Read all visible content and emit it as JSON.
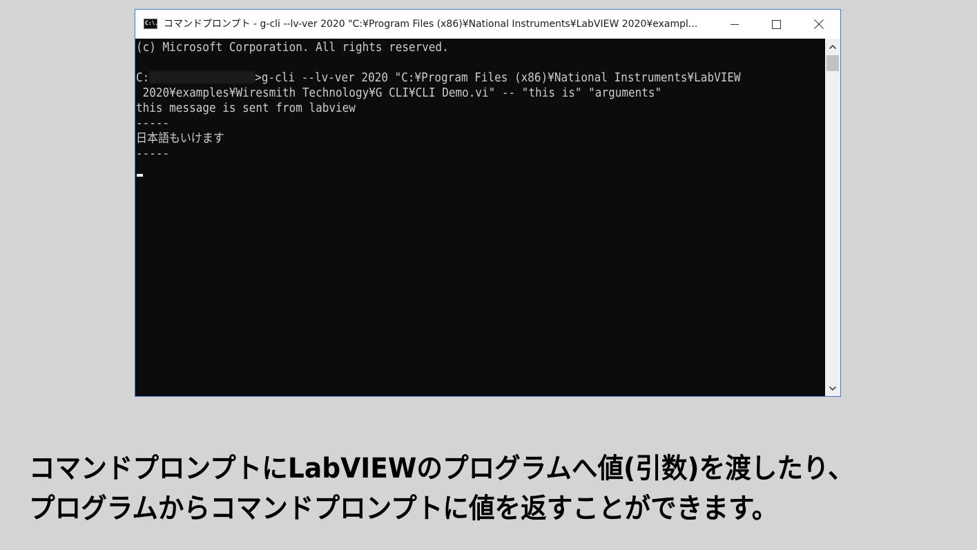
{
  "window": {
    "title": "コマンドプロンプト - g-cli  --lv-ver 2020 \"C:¥Program Files (x86)¥National Instruments¥LabVIEW 2020¥exampl...",
    "icon_label": "C:\\.",
    "controls": [
      "minimize-icon",
      "maximize-icon",
      "close-icon"
    ]
  },
  "console": {
    "lines": [
      "(c) Microsoft Corporation. All rights reserved.",
      "",
      ">g-cli --lv-ver 2020 \"C:¥Program Files (x86)¥National Instruments¥LabVIEW",
      " 2020¥examples¥Wiresmith Technology¥G CLI¥CLI Demo.vi\" -- \"this is\" \"arguments\"",
      "this message is sent from labview",
      "-----",
      "日本語もいけます",
      "-----"
    ],
    "prompt_prefix": "C:",
    "text_color": "#cccccc",
    "background": "#0c0c0c"
  },
  "caption": {
    "line1": "コマンドプロンプトにLabVIEWのプログラムへ値(引数)を渡したり、",
    "line2": "プログラムからコマンドプロンプトに値を返すことができます。"
  },
  "colors": {
    "page_background": "#d4d4d4",
    "window_border": "#3c78c8",
    "scrollbar_track": "#f0f0f0",
    "scrollbar_thumb": "#c2c2c2"
  }
}
